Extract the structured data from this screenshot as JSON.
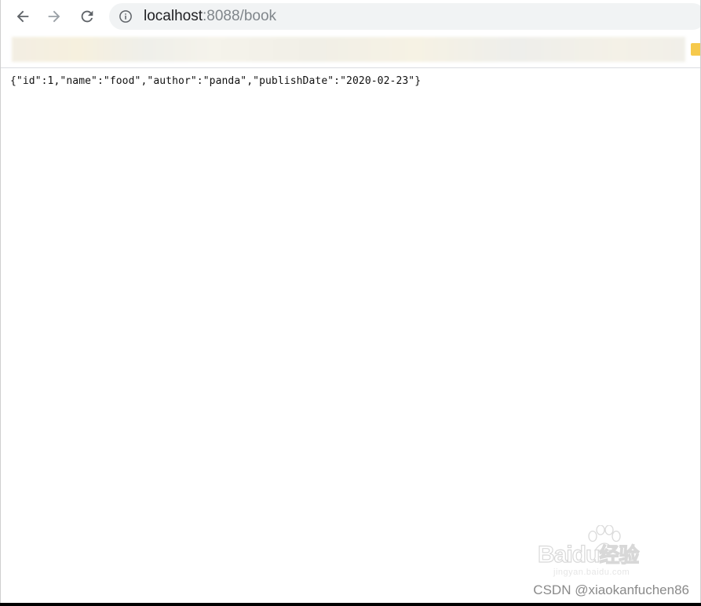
{
  "browser": {
    "url": {
      "host": "localhost",
      "rest": ":8088/book"
    },
    "icons": {
      "back": "arrow-back-icon",
      "forward": "arrow-forward-icon",
      "reload": "reload-icon",
      "site_info": "info-icon",
      "bookmark_folder": "folder-icon"
    }
  },
  "content": {
    "json_text": "{\"id\":1,\"name\":\"food\",\"author\":\"panda\",\"publishDate\":\"2020-02-23\"}"
  },
  "watermarks": {
    "baidu_logo": "Baidu",
    "baidu_brand": "经验",
    "baidu_url": "jingyan.baidu.com",
    "csdn": "CSDN @xiaokanfuchen86"
  },
  "colors": {
    "omnibox_bg": "#f1f3f4",
    "host_text": "#202124",
    "url_rest_text": "#80868b",
    "bookmark_folder": "#f6c94b"
  }
}
